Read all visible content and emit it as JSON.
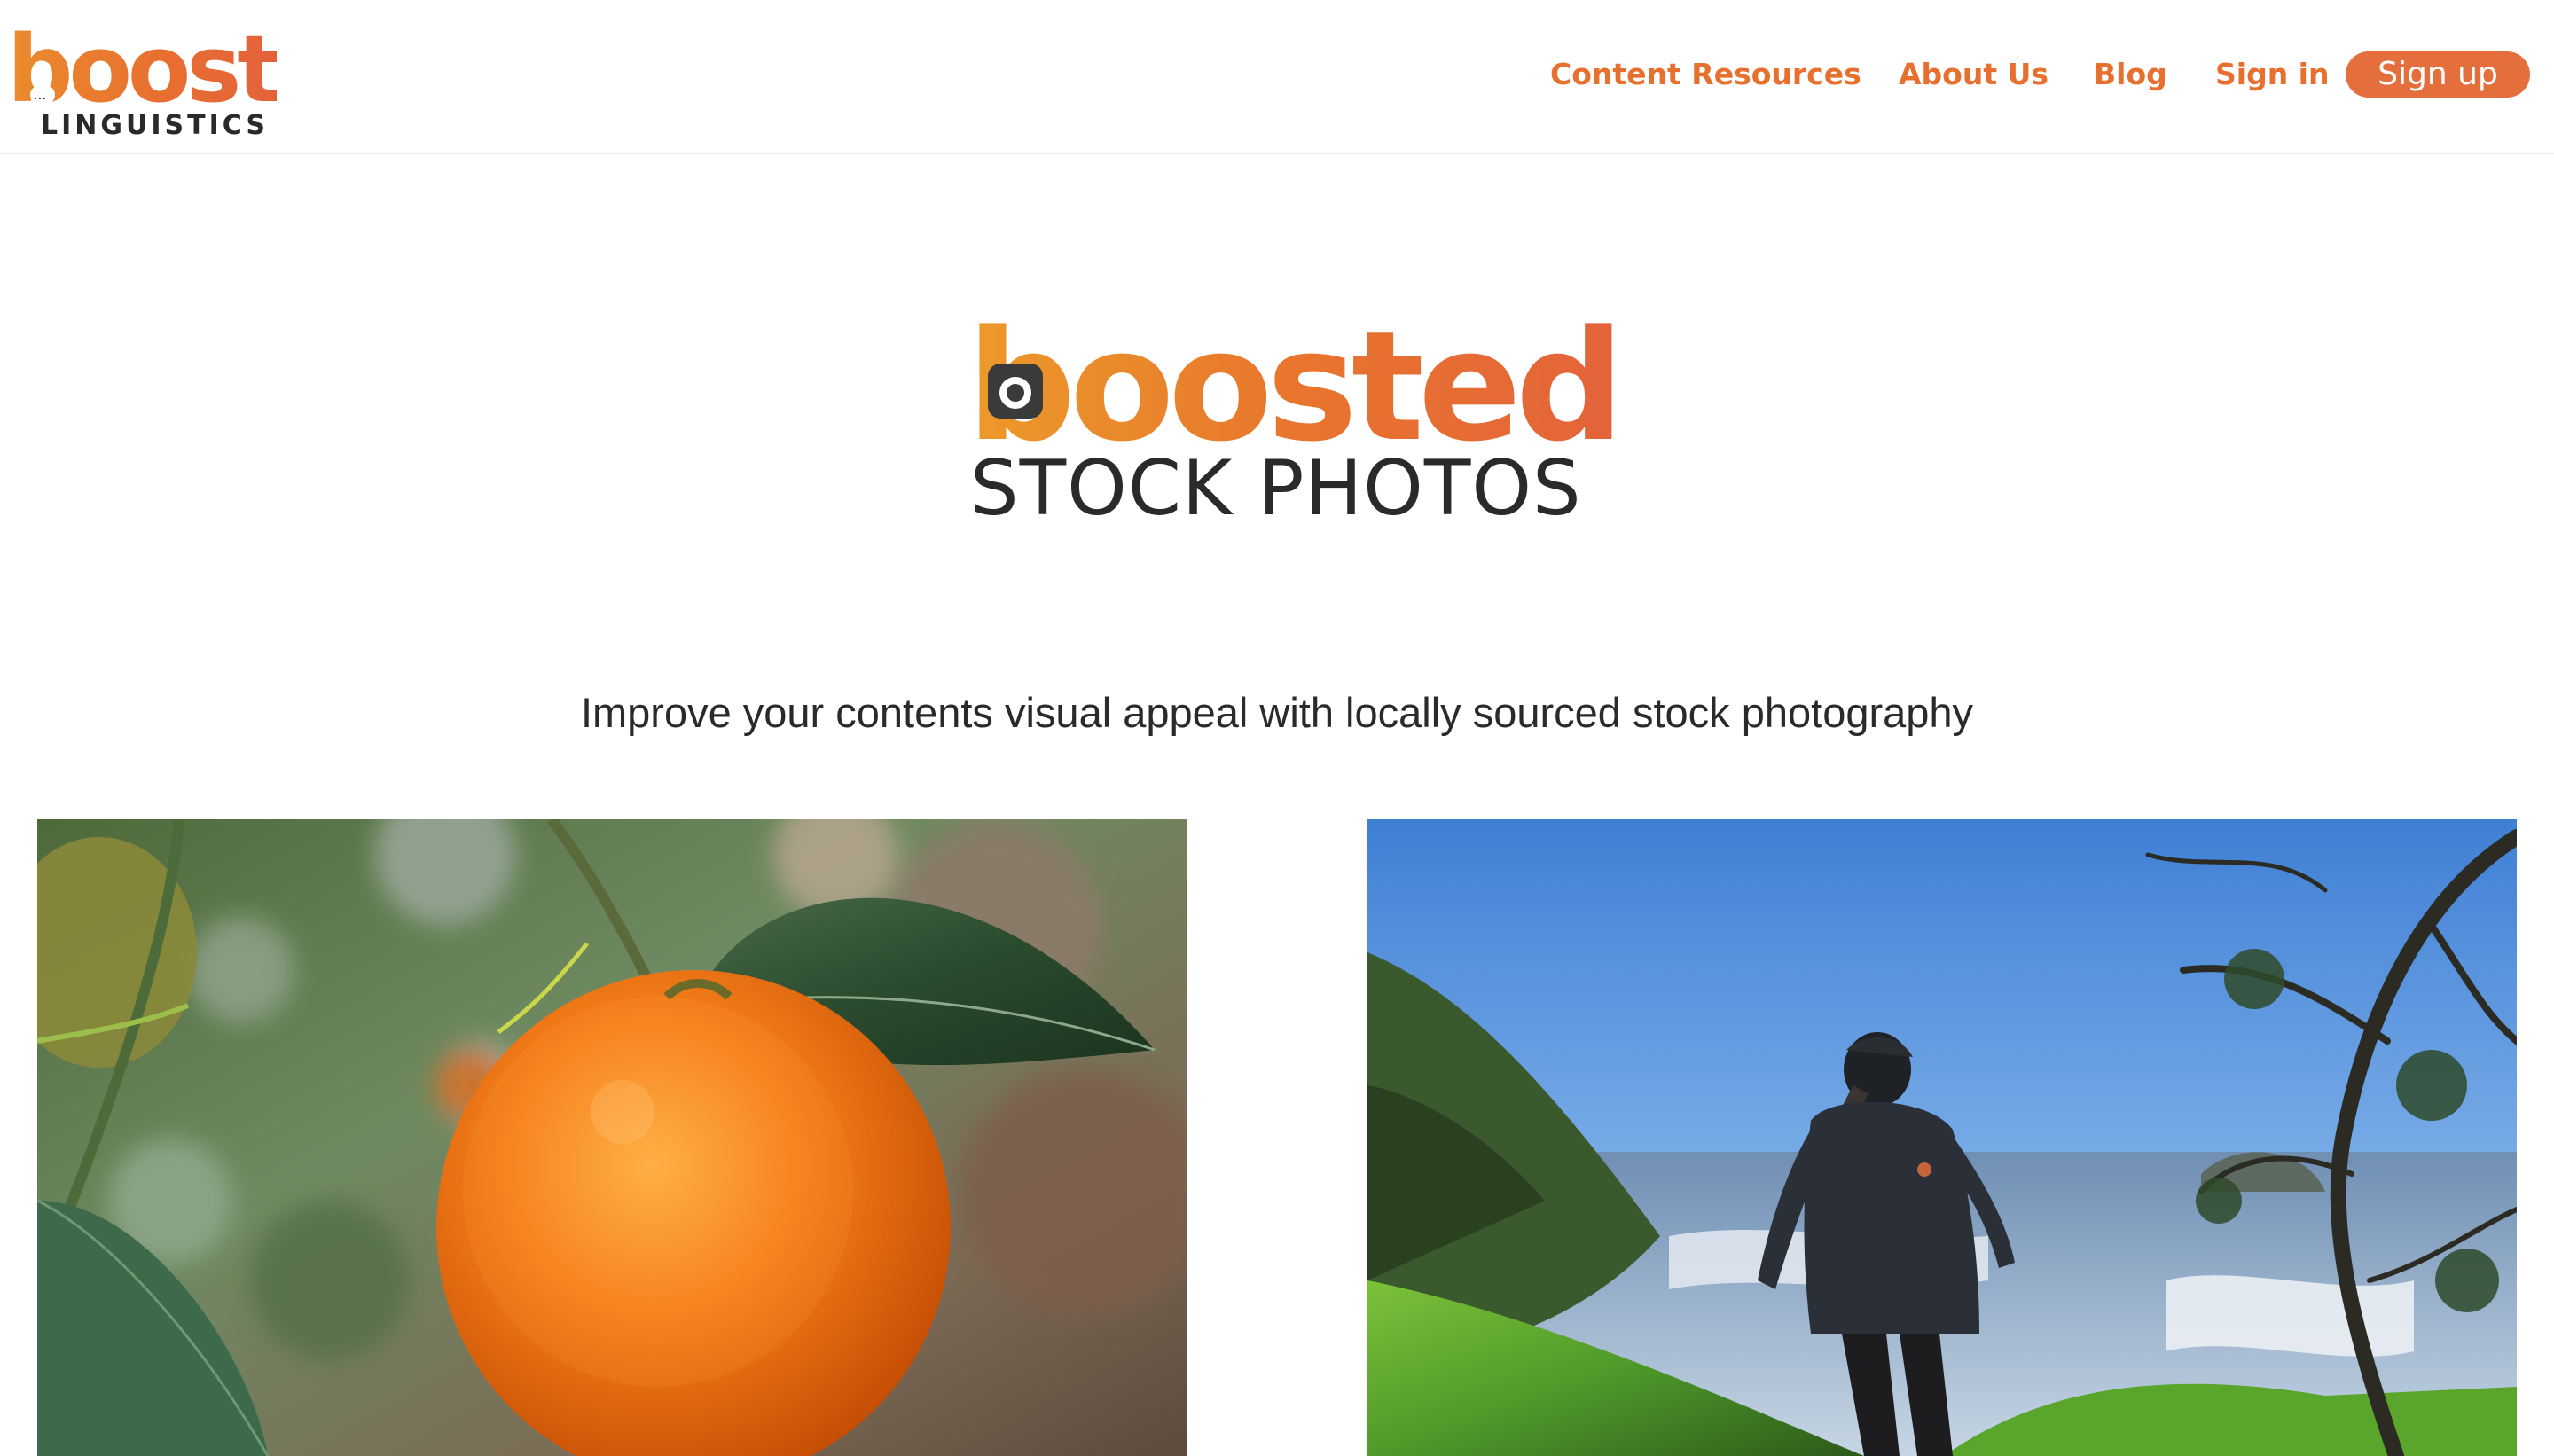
{
  "header": {
    "logo": {
      "wordmark": "boost",
      "subtitle": "LINGUISTICS",
      "bubble": "..."
    },
    "nav": [
      {
        "label": "Content Resources"
      },
      {
        "label": "About Us"
      },
      {
        "label": "Blog"
      },
      {
        "label": "Sign in"
      }
    ],
    "signup_label": "Sign up"
  },
  "brand": {
    "wordmark": "boosted",
    "subtitle": "STOCK PHOTOS"
  },
  "tagline": "Improve your contents visual appeal with locally sourced stock photography",
  "colors": {
    "accent": "#e8702f",
    "signup_bg": "#e46f3c",
    "text": "#2a2a2a"
  },
  "photos": [
    {
      "subject": "orange-on-branch-photo"
    },
    {
      "subject": "hiker-coastal-trail-photo"
    }
  ]
}
